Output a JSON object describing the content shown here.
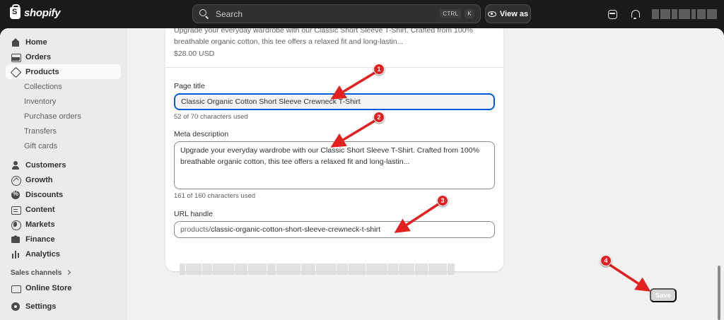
{
  "topbar": {
    "logo_text": "shopify",
    "search_placeholder": "Search",
    "shortcut_ctrl": "CTRL",
    "shortcut_key": "K",
    "view_as_label": "View as"
  },
  "sidebar": {
    "items": [
      {
        "label": "Home",
        "icon": "home-icon"
      },
      {
        "label": "Orders",
        "icon": "orders-icon"
      },
      {
        "label": "Products",
        "icon": "tag-icon",
        "active": true
      },
      {
        "label": "Customers",
        "icon": "customers-icon"
      },
      {
        "label": "Growth",
        "icon": "growth-icon"
      },
      {
        "label": "Discounts",
        "icon": "discounts-icon"
      },
      {
        "label": "Content",
        "icon": "content-icon"
      },
      {
        "label": "Markets",
        "icon": "markets-icon"
      },
      {
        "label": "Finance",
        "icon": "finance-icon"
      },
      {
        "label": "Analytics",
        "icon": "analytics-icon"
      }
    ],
    "product_subitems": [
      "Collections",
      "Inventory",
      "Purchase orders",
      "Transfers",
      "Gift cards"
    ],
    "sales_channels_label": "Sales channels",
    "online_store_label": "Online Store",
    "settings_label": "Settings"
  },
  "seo": {
    "preview_description": "Upgrade your everyday wardrobe with our Classic Short Sleeve T-Shirt. Crafted from 100% breathable organic cotton, this tee offers a relaxed fit and long-lastin...",
    "preview_price": "$28.00 USD",
    "page_title_label": "Page title",
    "page_title_value": "Classic Organic Cotton Short Sleeve Crewneck T-Shirt",
    "page_title_help": "52 of 70 characters used",
    "meta_description_label": "Meta description",
    "meta_description_value": "Upgrade your everyday wardrobe with our Classic Short Sleeve T-Shirt. Crafted from 100% breathable organic cotton, this tee offers a relaxed fit and long-lastin...",
    "meta_description_help": "161 of 160 characters used",
    "url_handle_label": "URL handle",
    "url_prefix": "products/",
    "url_handle_value": "classic-organic-cotton-short-sleeve-crewneck-t-shirt"
  },
  "actions": {
    "save_label": "Save"
  },
  "annotations": {
    "badges": [
      "1",
      "2",
      "3",
      "4"
    ]
  },
  "colors": {
    "accent_focus": "#005bd3",
    "annotation_red": "#e32020",
    "topbar_bg": "#1a1a1a"
  }
}
